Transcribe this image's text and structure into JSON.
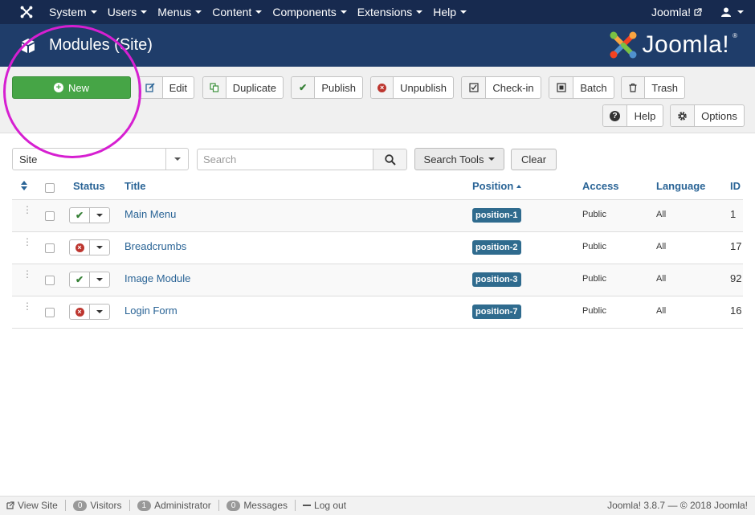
{
  "topnav": {
    "menus": [
      "System",
      "Users",
      "Menus",
      "Content",
      "Components",
      "Extensions",
      "Help"
    ],
    "site_label": "Joomla!"
  },
  "header": {
    "title": "Modules (Site)",
    "brand": "Joomla!"
  },
  "toolbar": {
    "new": "New",
    "edit": "Edit",
    "duplicate": "Duplicate",
    "publish": "Publish",
    "unpublish": "Unpublish",
    "checkin": "Check-in",
    "batch": "Batch",
    "trash": "Trash",
    "help": "Help",
    "options": "Options"
  },
  "filters": {
    "client": "Site",
    "search_placeholder": "Search",
    "search_tools": "Search Tools",
    "clear": "Clear"
  },
  "table": {
    "headers": {
      "status": "Status",
      "title": "Title",
      "position": "Position",
      "access": "Access",
      "language": "Language",
      "id": "ID"
    },
    "rows": [
      {
        "published": true,
        "title": "Main Menu",
        "position": "position-1",
        "access": "Public",
        "language": "All",
        "id": "1"
      },
      {
        "published": false,
        "title": "Breadcrumbs",
        "position": "position-2",
        "access": "Public",
        "language": "All",
        "id": "17"
      },
      {
        "published": true,
        "title": "Image Module",
        "position": "position-3",
        "access": "Public",
        "language": "All",
        "id": "92"
      },
      {
        "published": false,
        "title": "Login Form",
        "position": "position-7",
        "access": "Public",
        "language": "All",
        "id": "16"
      }
    ]
  },
  "footer": {
    "view_site": "View Site",
    "visitors_count": "0",
    "visitors": "Visitors",
    "admin_count": "1",
    "admin": "Administrator",
    "messages_count": "0",
    "messages": "Messages",
    "logout": "Log out",
    "version": "Joomla! 3.8.7  —  © 2018 Joomla!"
  },
  "colors": {
    "nav": "#172a4f",
    "header": "#1f3d6a",
    "new_button": "#46a546",
    "link": "#2a6496",
    "badge": "#2f6b8e",
    "highlight": "#d61fd1"
  }
}
